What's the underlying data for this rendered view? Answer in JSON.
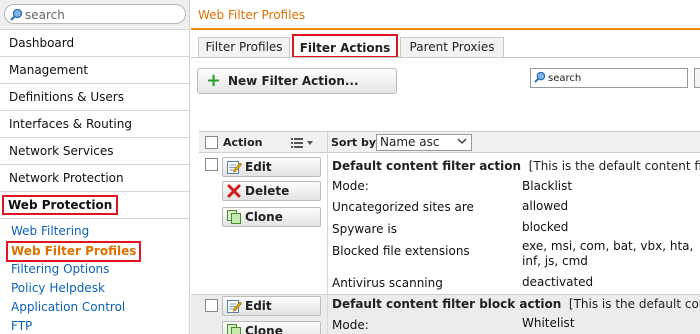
{
  "sidebar": {
    "search_placeholder": "search",
    "nav": [
      {
        "label": "Dashboard"
      },
      {
        "label": "Management"
      },
      {
        "label": "Definitions & Users"
      },
      {
        "label": "Interfaces & Routing"
      },
      {
        "label": "Network Services"
      },
      {
        "label": "Network Protection"
      },
      {
        "label": "Web Protection"
      }
    ],
    "sub_items": [
      {
        "label": "Web Filtering"
      },
      {
        "label": "Web Filter Profiles"
      },
      {
        "label": "Filtering Options"
      },
      {
        "label": "Policy Helpdesk"
      },
      {
        "label": "Application Control"
      },
      {
        "label": "FTP"
      }
    ]
  },
  "main": {
    "title": "Web Filter Profiles",
    "tabs": [
      {
        "label": "Filter Profiles"
      },
      {
        "label": "Filter Actions",
        "active": true
      },
      {
        "label": "Parent Proxies"
      }
    ],
    "new_button_label": "New Filter Action...",
    "search_placeholder": "search",
    "grid": {
      "action_header": "Action",
      "sort_label": "Sort by:",
      "sort_value": "Name asc"
    },
    "rows": [
      {
        "actions": {
          "edit": "Edit",
          "delete": "Delete",
          "clone": "Clone"
        },
        "name": "Default content filter action",
        "description": "[This is the default content filter action",
        "properties": [
          {
            "label": "Mode:",
            "value": "Blacklist"
          },
          {
            "label": "Uncategorized sites are",
            "value": "allowed"
          },
          {
            "label": "Spyware is",
            "value": "blocked"
          },
          {
            "label": "Blocked file extensions",
            "value": "exe, msi, com, bat, vbx, hta, inf, js, cmd"
          },
          {
            "label": "Antivirus scanning",
            "value": "deactivated"
          }
        ]
      },
      {
        "actions": {
          "edit": "Edit",
          "clone": "Clone"
        },
        "name": "Default content filter block action",
        "description": "[This is the default content filter",
        "properties": [
          {
            "label": "Mode:",
            "value": "Whitelist"
          }
        ]
      }
    ]
  },
  "colors": {
    "accent_orange": "#e07000",
    "link_blue": "#0b62b8",
    "highlight_red": "#e0141e",
    "add_green": "#2e9e2e"
  },
  "icons": [
    "magnifier-icon",
    "plus-icon",
    "list-menu-icon",
    "chevron-down-icon",
    "edit-icon",
    "delete-icon",
    "clone-icon"
  ]
}
